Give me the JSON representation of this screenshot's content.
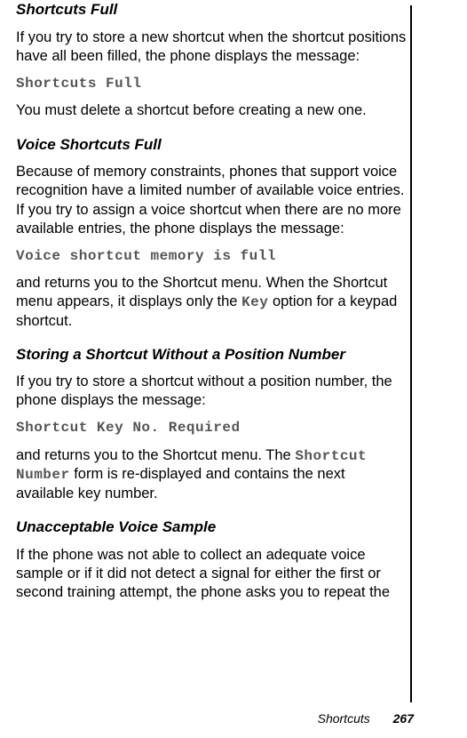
{
  "section1": {
    "heading": "Shortcuts Full",
    "para1": "If you try to store a new shortcut when the shortcut positions have all been filled, the phone displays the message:",
    "mono": "Shortcuts Full",
    "para2": "You must delete a shortcut before creating a new one."
  },
  "section2": {
    "heading": "Voice Shortcuts Full",
    "para1": "Because of memory constraints, phones that support voice recognition have a limited number of available voice entries. If you try to assign a voice shortcut when there are no more available entries, the phone displays the message:",
    "mono": "Voice shortcut memory is full",
    "para2a": "and returns you to the Shortcut menu. When the Shortcut menu appears, it displays only the ",
    "key": "Key",
    "para2b": " option for a keypad shortcut."
  },
  "section3": {
    "heading": "Storing a Shortcut Without a Position Number",
    "para1": "If you try to store a shortcut without a position number, the phone displays the message:",
    "mono": "Shortcut Key No. Required",
    "para2a": "and returns you to the Shortcut menu. The ",
    "monoInline": "Shortcut Number",
    "para2b": " form is re-displayed and contains the next available key number."
  },
  "section4": {
    "heading": "Unacceptable Voice Sample",
    "para1": "If the phone was not able to collect an adequate voice sample or if it did not detect a signal for either the first or second training attempt, the phone asks you to repeat the"
  },
  "footer": {
    "label": "Shortcuts",
    "page": "267"
  }
}
